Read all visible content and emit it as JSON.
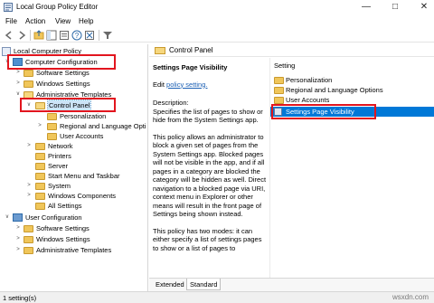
{
  "window": {
    "title": "Local Group Policy Editor"
  },
  "menu": [
    "File",
    "Action",
    "View",
    "Help"
  ],
  "tree": [
    {
      "label": "Local Computer Policy"
    },
    {
      "label": "Computer Configuration"
    },
    {
      "label": "Software Settings"
    },
    {
      "label": "Windows Settings"
    },
    {
      "label": "Administrative Templates"
    },
    {
      "label": "Control Panel"
    },
    {
      "label": "Personalization"
    },
    {
      "label": "Regional and Language Opti"
    },
    {
      "label": "User Accounts"
    },
    {
      "label": "Network"
    },
    {
      "label": "Printers"
    },
    {
      "label": "Server"
    },
    {
      "label": "Start Menu and Taskbar"
    },
    {
      "label": "System"
    },
    {
      "label": "Windows Components"
    },
    {
      "label": "All Settings"
    },
    {
      "label": "User Configuration"
    },
    {
      "label": "Software Settings"
    },
    {
      "label": "Windows Settings"
    },
    {
      "label": "Administrative Templates"
    }
  ],
  "header": {
    "title": "Control Panel"
  },
  "description": {
    "title": "Settings Page Visibility",
    "edit_prefix": "Edit",
    "edit_link": "policy setting.",
    "label": "Description:",
    "p1": "Specifies the list of pages to show or hide from the System Settings app.",
    "p2": "This policy allows an administrator to block a given set of pages from the System Settings app. Blocked pages will not be visible in the app, and if all pages in a category are blocked the category will be hidden as well. Direct navigation to a blocked page via URI, context menu in Explorer or other means will result in the front page of Settings being shown instead.",
    "p3": "This policy has two modes: it can either specify a list of settings pages to show or a list of pages to"
  },
  "list": {
    "column": "Setting",
    "items": [
      {
        "label": "Personalization"
      },
      {
        "label": "Regional and Language Options"
      },
      {
        "label": "User Accounts"
      },
      {
        "label": "Settings Page Visibility"
      }
    ]
  },
  "tabs": [
    "Extended",
    "Standard"
  ],
  "status": {
    "text": "1 setting(s)"
  },
  "watermark": "wsxdn.com",
  "colors": {
    "highlight_box": "#e2151e",
    "selection": "#0078d7"
  }
}
